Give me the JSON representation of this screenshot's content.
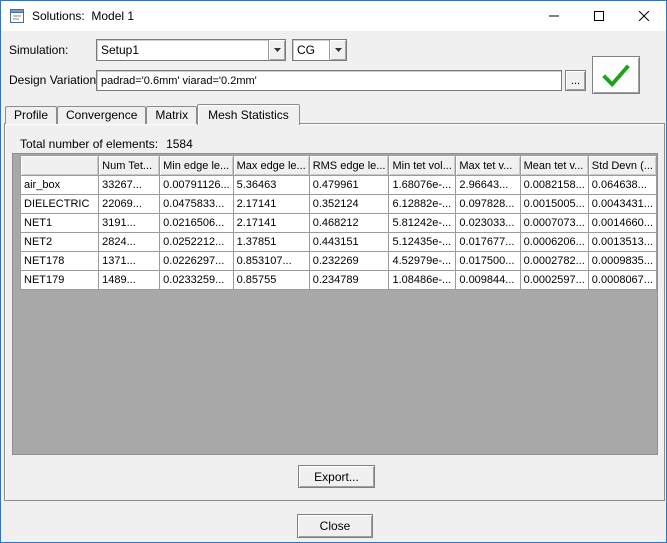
{
  "window": {
    "title": "Solutions:  Model 1"
  },
  "toolbar": {
    "simulation_label": "Simulation:",
    "simulation_value": "Setup1",
    "solution_type_value": "CG",
    "design_variation_label": "Design Variation:",
    "design_variation_value": "padrad='0.6mm' viarad='0.2mm'",
    "browse_label": "..."
  },
  "tabs": [
    {
      "label": "Profile"
    },
    {
      "label": "Convergence"
    },
    {
      "label": "Matrix"
    },
    {
      "label": "Mesh Statistics"
    }
  ],
  "mesh_stats": {
    "total_label": "Total number of elements:",
    "total_value": "1584",
    "columns": [
      "",
      "Num Tet...",
      "Min edge le...",
      "Max edge le...",
      "RMS edge le...",
      "Min tet vol...",
      "Max tet v...",
      "Mean tet v...",
      "Std Devn (..."
    ],
    "rows": [
      {
        "name": "air_box",
        "values": [
          "33267...",
          "0.00791126...",
          "5.36463",
          "0.479961",
          "1.68076e-...",
          "2.96643...",
          "0.0082158...",
          "0.064638..."
        ]
      },
      {
        "name": "DIELECTRIC",
        "values": [
          "22069...",
          "0.0475833...",
          "2.17141",
          "0.352124",
          "6.12882e-...",
          "0.097828...",
          "0.0015005...",
          "0.0043431..."
        ]
      },
      {
        "name": "NET1",
        "values": [
          "3191...",
          "0.0216506...",
          "2.17141",
          "0.468212",
          "5.81242e-...",
          "0.023033...",
          "0.0007073...",
          "0.0014660..."
        ]
      },
      {
        "name": "NET2",
        "values": [
          "2824...",
          "0.0252212...",
          "1.37851",
          "0.443151",
          "5.12435e-...",
          "0.017677...",
          "0.0006206...",
          "0.0013513..."
        ]
      },
      {
        "name": "NET178",
        "values": [
          "1371...",
          "0.0226297...",
          "0.853107...",
          "0.232269",
          "4.52979e-...",
          "0.017500...",
          "0.0002782...",
          "0.0009835..."
        ]
      },
      {
        "name": "NET179",
        "values": [
          "1489...",
          "0.0233259...",
          "0.85755",
          "0.234789",
          "1.08486e-...",
          "0.009844...",
          "0.0002597...",
          "0.0008067..."
        ]
      }
    ]
  },
  "buttons": {
    "export_label": "Export...",
    "close_label": "Close"
  },
  "colors": {
    "accent_border": "#3573b9",
    "check_green": "#1fa11f",
    "grid_background": "#a8a8a8"
  }
}
